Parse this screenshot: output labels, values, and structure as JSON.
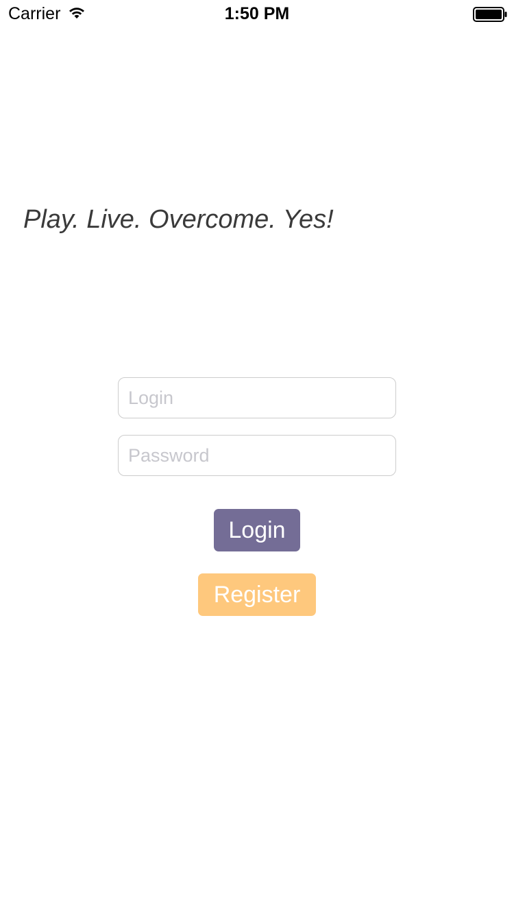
{
  "status_bar": {
    "carrier": "Carrier",
    "time": "1:50 PM",
    "wifi_icon": "wifi-icon",
    "battery_icon": "battery-full-icon"
  },
  "tagline": "Play. Live. Overcome. Yes!",
  "form": {
    "login_placeholder": "Login",
    "login_value": "",
    "password_placeholder": "Password",
    "password_value": ""
  },
  "buttons": {
    "login_label": "Login",
    "register_label": "Register"
  },
  "colors": {
    "login_button": "#746d96",
    "register_button": "#fec87d",
    "tagline_text": "#3a3a3a",
    "field_border": "#cccccc",
    "placeholder": "#c7c7cd"
  }
}
